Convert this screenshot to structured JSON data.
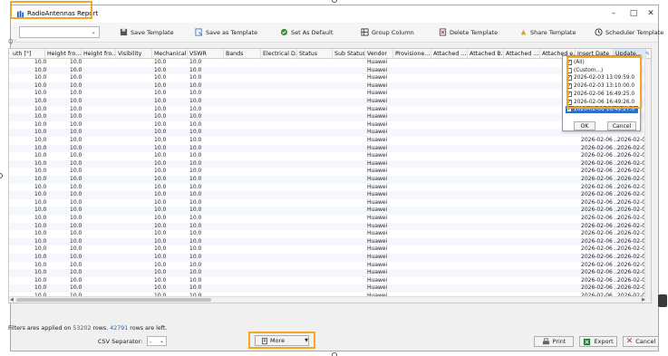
{
  "window": {
    "title": "RadioAntennas Report",
    "controls": [
      "–",
      "□",
      "✕"
    ]
  },
  "toolbar": {
    "template_select_value": "",
    "save_template": "Save Template",
    "save_as_template": "Save as Template",
    "set_as_default": "Set As Default",
    "group_column": "Group Column",
    "delete_template": "Delete Template",
    "share_template": "Share Template",
    "scheduler_template": "Scheduler Template"
  },
  "filter": {
    "icon": "filter-icon"
  },
  "grid": {
    "columns": [
      "uth [°]",
      "Height fro...",
      "Height fro...",
      "Visibility",
      "Mechanical...",
      "VSWR",
      "Bands",
      "Electrical D...",
      "Status",
      "Sub Status",
      "Vendor",
      "Provisione...",
      "Attached ...",
      "Attached B...",
      "Attached ...",
      "Attached e...",
      "Insert Date",
      "Update..."
    ],
    "row_values": {
      "c0": "10.0",
      "c1": "10.0",
      "c4": "10.0",
      "c5": "10.0",
      "vendor": "Huawei",
      "insert_date": "2026-02-06 ...",
      "update_date": "2026-02-06 ..."
    },
    "row_count_visible": 31
  },
  "dropdown": {
    "items": [
      {
        "label": "(All)",
        "checked": true
      },
      {
        "label": "(Custom...)",
        "checked": false
      },
      {
        "label": "2026-02-03 13:09:59.0",
        "checked": true
      },
      {
        "label": "2026-02-03 13:10:00.0",
        "checked": true
      },
      {
        "label": "2026-02-06 16:49:25.0",
        "checked": true
      },
      {
        "label": "2026-02-06 16:49:26.0",
        "checked": true
      },
      {
        "label": "2026-02-06 16:49:27.0",
        "checked": true
      }
    ],
    "ok": "OK",
    "cancel": "Cancel"
  },
  "footer": {
    "filter_prefix": "Filters ares applied on ",
    "total_rows": "53202",
    "filter_middle": " rows. ",
    "rows_left": "42791",
    "filter_suffix": " rows are left.",
    "csv_label": "CSV Separator:",
    "csv_value": ",",
    "more": "More",
    "print": "Print",
    "export": "Export",
    "cancel": "Cancel"
  },
  "colors": {
    "highlight": "#f5a623",
    "link": "#1a5fb4",
    "selection": "#2f6fc7"
  }
}
